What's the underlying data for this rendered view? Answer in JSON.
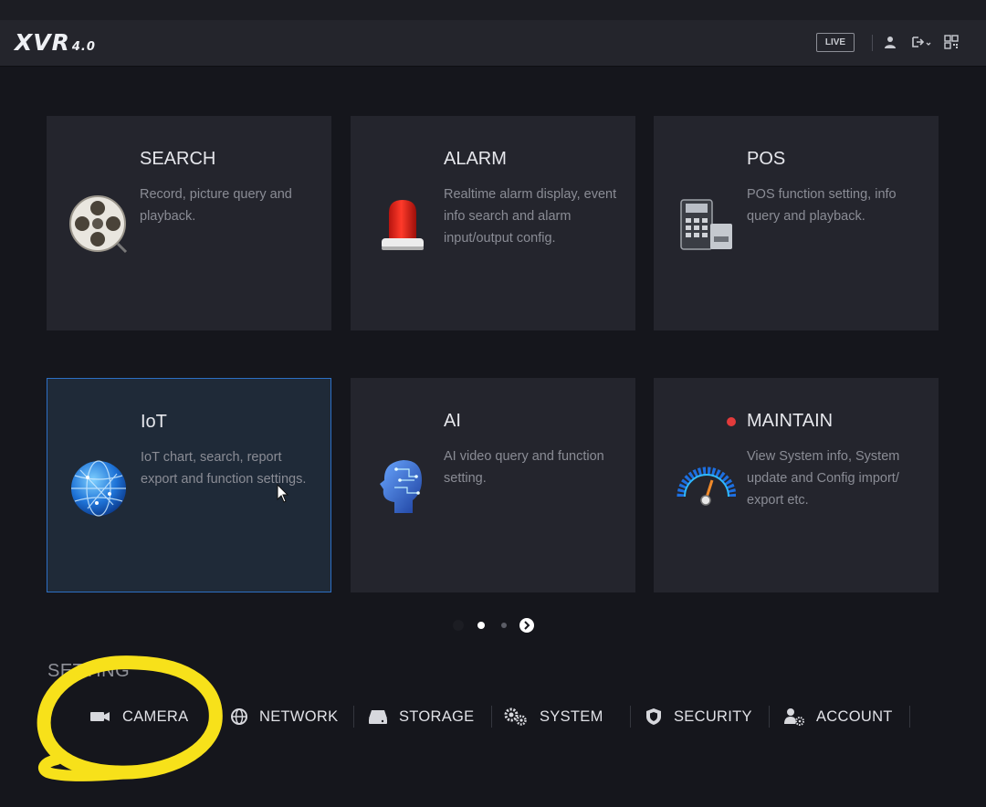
{
  "header": {
    "logo_main": "XVR",
    "logo_version": "4.0",
    "live_label": "LIVE",
    "icons": [
      "user-icon",
      "logout-icon",
      "qr-code-icon"
    ]
  },
  "cards": [
    {
      "title": "SEARCH",
      "desc": "Record, picture query and playback.",
      "icon": "film-reel-icon",
      "selected": false
    },
    {
      "title": "ALARM",
      "desc": "Realtime alarm display, event info search and alarm input/output config.",
      "icon": "alarm-siren-icon",
      "selected": false
    },
    {
      "title": "POS",
      "desc": "POS function setting, info query and playback.",
      "icon": "pos-terminal-icon",
      "selected": false
    },
    {
      "title": "IoT",
      "desc": "IoT chart, search, report export and function settings.",
      "icon": "globe-icon",
      "selected": true
    },
    {
      "title": "AI",
      "desc": "AI video query and function setting.",
      "icon": "ai-head-icon",
      "selected": false
    },
    {
      "title": "MAINTAIN",
      "desc": "View System info, System update and Config import/ export etc.",
      "icon": "gauge-icon",
      "selected": false,
      "notification": true
    }
  ],
  "pager": {
    "pages": 3,
    "current": 2
  },
  "settings": {
    "label": "SETTING",
    "items": [
      {
        "label": "CAMERA",
        "icon": "camera-icon"
      },
      {
        "label": "NETWORK",
        "icon": "network-globe-icon"
      },
      {
        "label": "STORAGE",
        "icon": "hard-drive-icon"
      },
      {
        "label": "SYSTEM",
        "icon": "gears-icon"
      },
      {
        "label": "SECURITY",
        "icon": "shield-icon"
      },
      {
        "label": "ACCOUNT",
        "icon": "account-gear-icon"
      }
    ]
  },
  "colors": {
    "background": "#15161c",
    "card": "#24252d",
    "selected_border": "#2c6fc4",
    "annotation": "#f7e11a",
    "badge": "#e33b3b"
  }
}
